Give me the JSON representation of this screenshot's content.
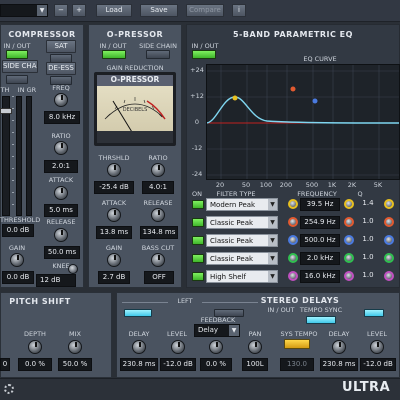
{
  "topbar": {
    "load": "Load",
    "save": "Save",
    "compare": "Compare",
    "info": "i",
    "minus": "−",
    "plus": "+"
  },
  "compressor": {
    "title": "COMPRESSOR",
    "in_out": "IN / OUT",
    "sat": "SAT",
    "side_chain": "SIDE CHAIN",
    "de_ess": "DE-ESS",
    "meter_left": "TH",
    "meter_in_gr": "IN GR",
    "freq_label": "FREQ",
    "freq": "8.0 kHz",
    "ratio_label": "RATIO",
    "ratio": "2.0:1",
    "attack_label": "ATTACK",
    "attack": "5.0 ms",
    "release_label": "RELEASE",
    "release": "50.0 ms",
    "threshold_label": "THRESHOLD",
    "threshold": "0.0 dB",
    "gain_label": "GAIN",
    "gain": "0.0 dB",
    "knee_label": "KNEE",
    "knee": "12 dB"
  },
  "opressor": {
    "title": "O-PRESSOR",
    "in_out": "IN / OUT",
    "side_chain": "SIDE CHAIN",
    "gain_reduction": "GAIN REDUCTION",
    "vu_name": "O-PRESSOR",
    "vu_sub": "DECIBELS",
    "thrshld_label": "THRSHLD",
    "thrshld": "-25.4 dB",
    "ratio_label": "RATIO",
    "ratio": "4.0:1",
    "attack_label": "ATTACK",
    "attack": "13.8 ms",
    "release_label": "RELEASE",
    "release": "134.8 ms",
    "gain_label": "GAIN",
    "gain": "2.7 dB",
    "bass_cut_label": "BASS CUT",
    "bass_cut": "OFF"
  },
  "eq": {
    "title": "5-BAND PARAMETRIC EQ",
    "in_out": "IN / OUT",
    "curve_label": "EQ CURVE",
    "y_ticks": [
      "+24",
      "+12",
      "0",
      "-12",
      "-24"
    ],
    "x_ticks": [
      "20",
      "50",
      "100",
      "200",
      "500",
      "1K",
      "2K",
      "5K"
    ],
    "col_on": "ON",
    "col_filter": "FILTER TYPE",
    "col_freq": "FREQUENCY",
    "col_q": "Q",
    "bands": [
      {
        "on": true,
        "type": "Modern Peak",
        "freq": "39.5 Hz",
        "q": "1.4",
        "color": "#e8c020"
      },
      {
        "on": true,
        "type": "Classic Peak",
        "freq": "254.9 Hz",
        "q": "1.0",
        "color": "#e25a30"
      },
      {
        "on": true,
        "type": "Classic Peak",
        "freq": "500.0 Hz",
        "q": "1.0",
        "color": "#4a7ae0"
      },
      {
        "on": true,
        "type": "Classic Peak",
        "freq": "2.0 kHz",
        "q": "1.0",
        "color": "#30c050"
      },
      {
        "on": true,
        "type": "High Shelf",
        "freq": "16.0 kHz",
        "q": "1.0",
        "color": "#c050c0"
      }
    ]
  },
  "pitch": {
    "title": "PITCH SHIFT",
    "depth_label": "DEPTH",
    "depth": "0.0 %",
    "mix_label": "MIX",
    "mix": "50.0 %",
    "first": "0"
  },
  "delays": {
    "title": "STEREO DELAYS",
    "left": "LEFT",
    "in_out": "IN / OUT",
    "tempo_sync": "TEMPO SYNC",
    "delay_label": "DELAY",
    "delay_l": "230.8 ms",
    "level_label": "LEVEL",
    "level_l": "-12.0 dB",
    "feedback_label": "FEEDBACK",
    "feedback_mode": "Delay",
    "feedback": "0.0 %",
    "pan_label": "PAN",
    "pan": "100L",
    "sys_tempo_label": "SYS TEMPO",
    "sys_tempo": "130.0",
    "delay_r": "230.8 ms",
    "level_r": "-12.0 dB"
  },
  "brand": {
    "name": "ULTRA"
  }
}
